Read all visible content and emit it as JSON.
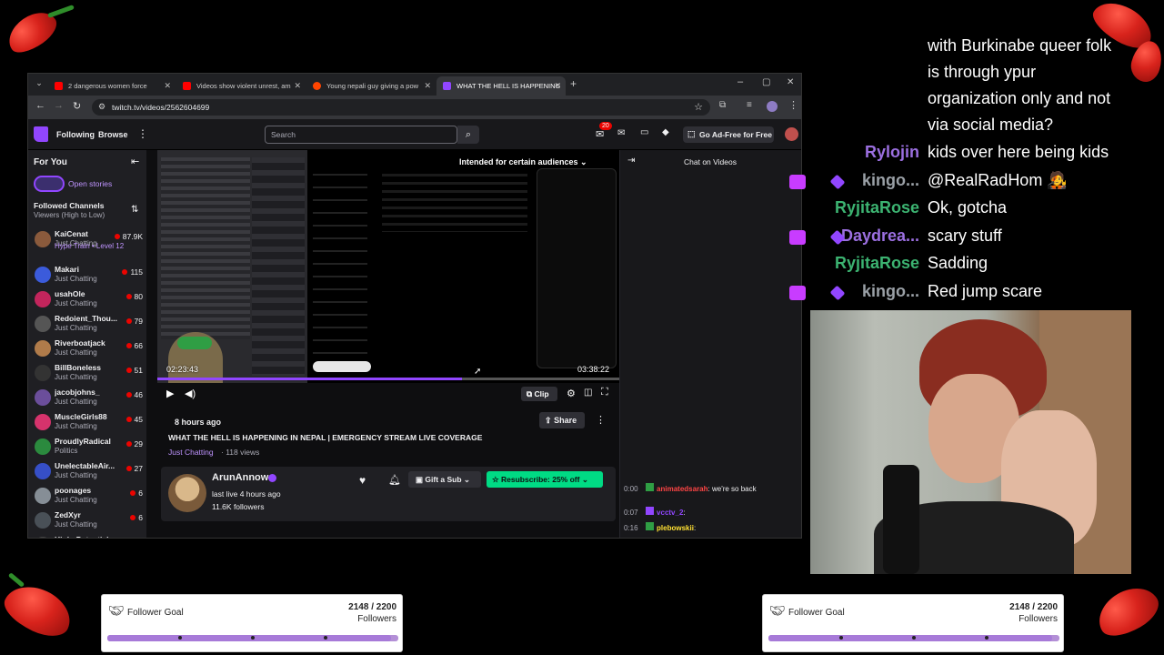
{
  "browser": {
    "tabs": [
      {
        "title": "2 dangerous women force",
        "icon": "youtube-icon",
        "color": "#ff0000"
      },
      {
        "title": "Videos show violent unrest, am",
        "icon": "youtube-icon",
        "color": "#ff0000"
      },
      {
        "title": "Young nepali guy giving a pow",
        "icon": "reddit-icon",
        "color": "#ff4500"
      },
      {
        "title": "WHAT THE HELL IS HAPPENING",
        "icon": "twitch-icon",
        "color": "#9146ff"
      }
    ],
    "url": "twitch.tv/videos/2562604699"
  },
  "twitch_nav": {
    "following": "Following",
    "browse": "Browse",
    "search_placeholder": "Search",
    "notifications": "20",
    "ad_free": "Go Ad-Free for Free"
  },
  "sidebar": {
    "for_you": "For You",
    "open_stories": "Open stories",
    "followed": "Followed Channels",
    "sort": "Viewers (High to Low)",
    "channels": [
      {
        "name": "KaiCenat",
        "category": "Just Chatting",
        "viewers": "87.9K",
        "color": "#8a5a3c"
      },
      {
        "name": "",
        "category": "Hype Train • Level 12",
        "viewers": "",
        "color": ""
      },
      {
        "name": "Makari",
        "category": "Just Chatting",
        "viewers": "115",
        "color": "#3b5bdb"
      },
      {
        "name": "usahOle",
        "category": "Just Chatting",
        "viewers": "80",
        "color": "#c2255c"
      },
      {
        "name": "Redoient_Thou...",
        "category": "Just Chatting",
        "viewers": "79",
        "color": "#555"
      },
      {
        "name": "Riverboatjack",
        "category": "Just Chatting",
        "viewers": "66",
        "color": "#b07b4a"
      },
      {
        "name": "BillBoneless",
        "category": "Just Chatting",
        "viewers": "51",
        "color": "#333"
      },
      {
        "name": "jacobjohns_",
        "category": "Just Chatting",
        "viewers": "46",
        "color": "#6b4e9b"
      },
      {
        "name": "MuscleGirls88",
        "category": "Just Chatting",
        "viewers": "45",
        "color": "#d6336c"
      },
      {
        "name": "ProudlyRadical",
        "category": "Politics",
        "viewers": "29",
        "color": "#2b8a3e"
      },
      {
        "name": "UnelectableAir...",
        "category": "Just Chatting",
        "viewers": "27",
        "color": "#364fc7"
      },
      {
        "name": "poonages",
        "category": "Just Chatting",
        "viewers": "6",
        "color": "#868e96"
      },
      {
        "name": "ZedXyr",
        "category": "Just Chatting",
        "viewers": "6",
        "color": "#495057"
      },
      {
        "name": "High_Potential",
        "category": "",
        "viewers": "",
        "color": "#444"
      }
    ]
  },
  "player": {
    "banner": "Intended for certain audiences",
    "elapsed": "02:23:43",
    "duration": "03:38:22",
    "clip": "Clip",
    "progress": 0.66
  },
  "video": {
    "time_ago": "8 hours ago",
    "title": "WHAT THE HELL IS HAPPENING IN NEPAL | EMERGENCY STREAM LIVE COVERAGE",
    "category": "Just Chatting",
    "views": "· 118 views",
    "share": "Share",
    "channel": "ArunAnnow",
    "last_live": "last live 4 hours ago",
    "followers": "11.6K followers",
    "gift": "Gift a Sub",
    "resub": "Resubscribe: 25% off"
  },
  "chat_panel": {
    "title": "Chat on Videos",
    "messages": [
      {
        "time": "0:00",
        "user": "animatedsarah",
        "text": ": we're so back",
        "color": "#ff4545"
      },
      {
        "time": "0:07",
        "user": "vcctv_2",
        "text": ":",
        "color": "#9146ff"
      },
      {
        "time": "0:16",
        "user": "plebowskii",
        "text": ":",
        "color": "#ffe033"
      }
    ]
  },
  "overlay_chat": {
    "top_text": [
      "with Burkinabe queer folk",
      "is through ypur",
      "organization only and not",
      "via social media?"
    ],
    "messages": [
      {
        "user": "Rylojin",
        "text": "kids over here being kids",
        "color": "#9b6fe0"
      },
      {
        "user": "kingo...",
        "text": "@RealRadHom 🧑‍🎤",
        "color": "#9aa0a6"
      },
      {
        "user": "RyjitaRose",
        "text": "Ok, gotcha",
        "color": "#3cb371"
      },
      {
        "user": "Daydrea...",
        "text": "scary stuff",
        "color": "#9b6fe0"
      },
      {
        "user": "RyjitaRose",
        "text": "Sadding",
        "color": "#3cb371"
      },
      {
        "user": "kingo...",
        "text": "Red jump scare",
        "color": "#9aa0a6"
      }
    ]
  },
  "goals": [
    {
      "title": "Follower Goal",
      "current": "2148 / 2200",
      "unit": "Followers",
      "progress": 0.976
    },
    {
      "title": "Follower Goal",
      "current": "2148 / 2200",
      "unit": "Followers",
      "progress": 0.976
    }
  ]
}
